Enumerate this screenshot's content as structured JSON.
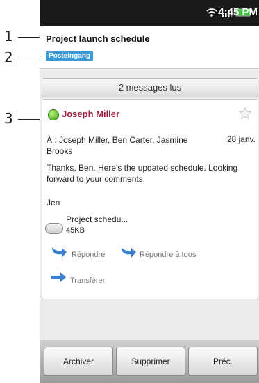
{
  "callouts": [
    "1",
    "2",
    "3"
  ],
  "status_bar": {
    "time": "4:45 PM",
    "icons": [
      "wifi-icon",
      "signal-icon",
      "battery-icon"
    ]
  },
  "header": {
    "subject": "Project launch schedule",
    "folder": "Posteingang"
  },
  "thread": {
    "read_count_label": "2 messages lus"
  },
  "message": {
    "sender": "Joseph Miller",
    "recipients": "À : Joseph Miller, Ben Carter, Jasmine Brooks",
    "date": "28 janv.",
    "body": "Thanks, Ben. Here's the updated schedule. Looking forward to your comments.",
    "signature": "Jen",
    "attachment": {
      "name": "Project schedu...",
      "size": "45KB"
    },
    "actions": {
      "reply": "Répondre",
      "reply_all": "Répondre à tous",
      "forward": "Transférer"
    }
  },
  "bottom_bar": {
    "archive": "Archiver",
    "delete": "Supprimer",
    "prev": "Préc."
  },
  "colors": {
    "sender": "#9a1b39",
    "badge": "#3b9ad6",
    "status_bar": "#1b1b1b",
    "battery": "#3fbf3f"
  }
}
